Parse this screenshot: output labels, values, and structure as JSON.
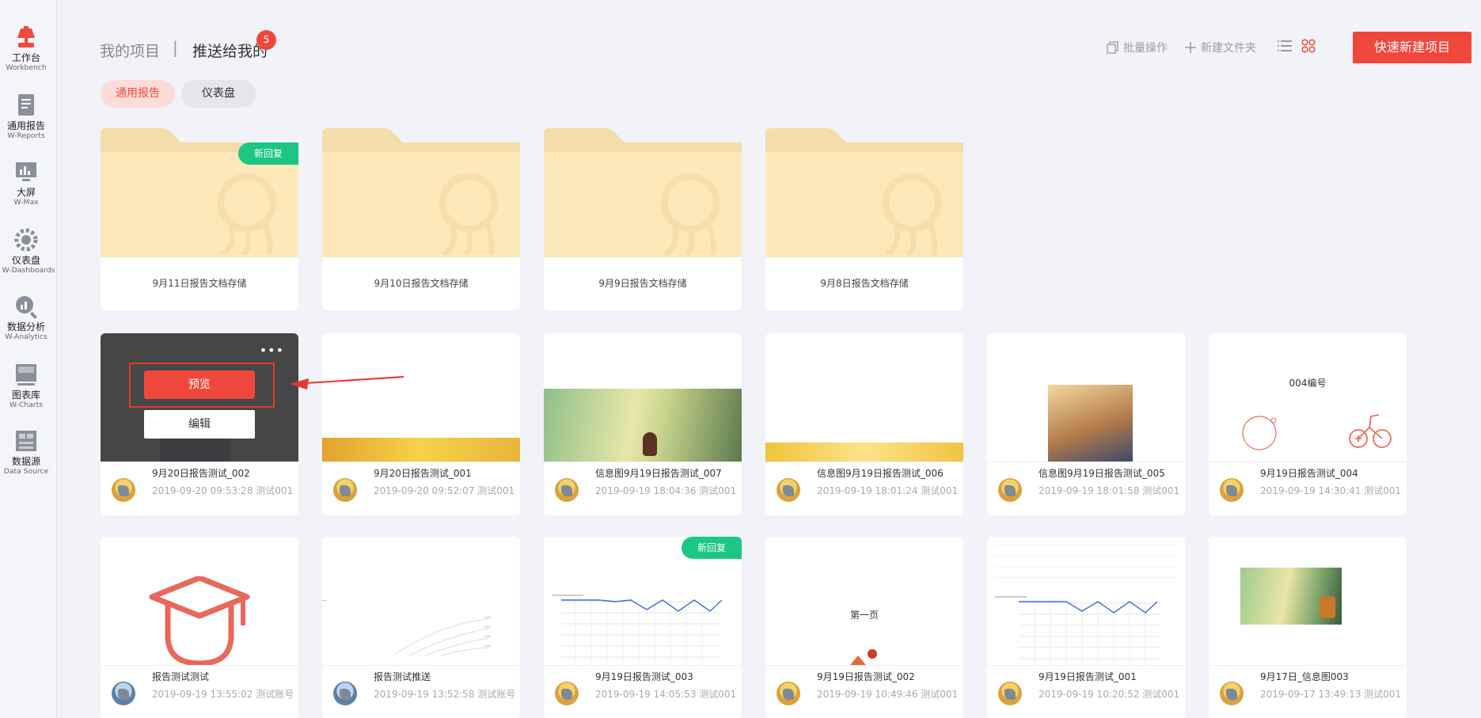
{
  "sidebar": {
    "items": [
      {
        "label": "工作台",
        "sub": "Workbench",
        "icon": "workbench-lamp-icon"
      },
      {
        "label": "通用报告",
        "sub": "W-Reports",
        "icon": "report-doc-icon"
      },
      {
        "label": "大屏",
        "sub": "W-Max",
        "icon": "big-screen-icon"
      },
      {
        "label": "仪表盘",
        "sub": "W-Dashboards",
        "icon": "dashboard-gear-icon"
      },
      {
        "label": "数据分析",
        "sub": "W-Analytics",
        "icon": "analytics-magnifier-icon"
      },
      {
        "label": "图表库",
        "sub": "W-Charts",
        "icon": "chart-library-icon"
      },
      {
        "label": "数据源",
        "sub": "Data Source",
        "icon": "data-source-icon"
      }
    ]
  },
  "header": {
    "tab_mine": "我的项目",
    "separator": "|",
    "tab_push": "推送给我的",
    "push_badge": "5",
    "batch_label": "批量操作",
    "new_folder_label": "新建文件夹",
    "quick_new_label": "快速新建项目"
  },
  "filters": {
    "general": "通用报告",
    "dashboard": "仪表盘"
  },
  "folders": [
    {
      "name": "9月11日报告文档存储",
      "tag": "新回复"
    },
    {
      "name": "9月10日报告文档存储"
    },
    {
      "name": "9月9日报告文档存储"
    },
    {
      "name": "9月8日报告文档存储"
    }
  ],
  "hover_card": {
    "preview_label": "预览",
    "edit_label": "编辑",
    "more": "•••"
  },
  "reports_row1": [
    {
      "title": "9月20日报告测试_002",
      "meta": "2019-09-20 09:53:28 测试001"
    },
    {
      "title": "9月20日报告测试_001",
      "meta": "2019-09-20 09:52:07 测试001"
    },
    {
      "title": "信息图9月19日报告测试_007",
      "meta": "2019-09-19 18:04:36 测试001"
    },
    {
      "title": "信息图9月19日报告测试_006",
      "meta": "2019-09-19 18:01:24 测试001"
    },
    {
      "title": "信息图9月19日报告测试_005",
      "meta": "2019-09-19 18:01:58 测试001"
    },
    {
      "title": "9月19日报告测试_004",
      "meta": "2019-09-19 14:30:41 测试001",
      "thumb_text": "004编号"
    }
  ],
  "reports_row2": [
    {
      "title": "报告测试测试",
      "meta": "2019-09-19 13:55:02 测试账号"
    },
    {
      "title": "报告测试推送",
      "meta": "2019-09-19 13:52:58 测试账号"
    },
    {
      "title": "9月19日报告测试_003",
      "meta": "2019-09-19 14:05:53 测试001",
      "tag": "新回复"
    },
    {
      "title": "9月19日报告测试_002",
      "meta": "2019-09-19 10:49:46 测试001",
      "thumb_text": "第一页"
    },
    {
      "title": "9月19日报告测试_001",
      "meta": "2019-09-19 10:20:52 测试001"
    },
    {
      "title": "9月17日_信息图003",
      "meta": "2019-09-17 13:49:13 测试001"
    }
  ],
  "colors": {
    "accent": "#f0473c",
    "new_tag": "#1cc784",
    "folder": "#fde8ba"
  }
}
